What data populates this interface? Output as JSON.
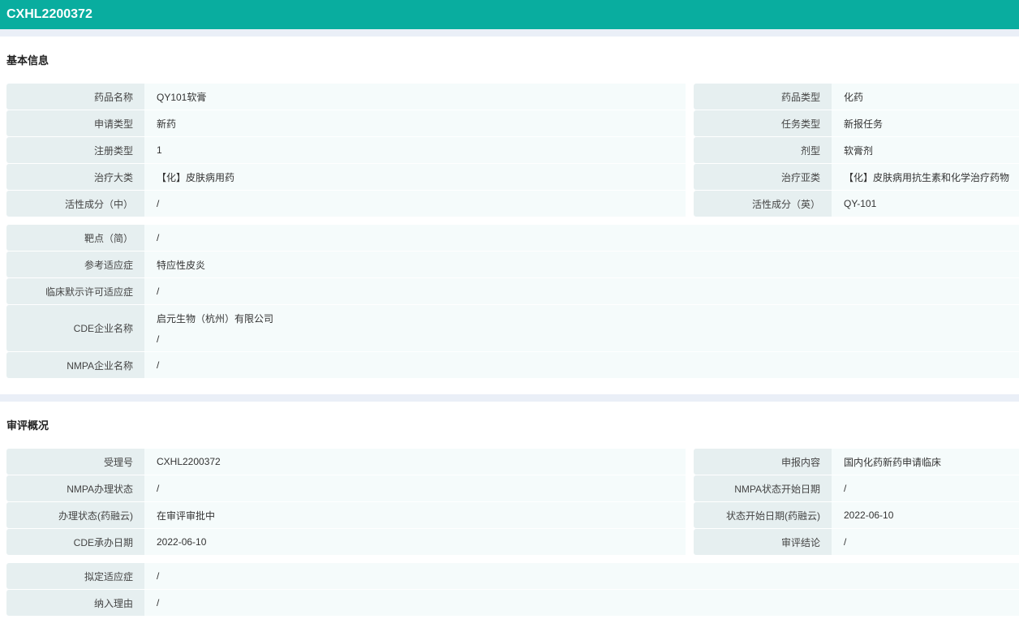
{
  "header": {
    "title": "CXHL2200372"
  },
  "basic": {
    "title": "基本信息",
    "left": [
      {
        "label": "药品名称",
        "value": "QY101软膏"
      },
      {
        "label": "申请类型",
        "value": "新药"
      },
      {
        "label": "注册类型",
        "value": "1"
      },
      {
        "label": "治疗大类",
        "value": "【化】皮肤病用药"
      },
      {
        "label": "活性成分（中）",
        "value": "/"
      }
    ],
    "right": [
      {
        "label": "药品类型",
        "value": "化药"
      },
      {
        "label": "任务类型",
        "value": "新报任务"
      },
      {
        "label": "剂型",
        "value": "软膏剂"
      },
      {
        "label": "治疗亚类",
        "value": "【化】皮肤病用抗生素和化学治疗药物"
      },
      {
        "label": "活性成分（英）",
        "value": "QY-101"
      }
    ],
    "full": [
      {
        "label": "靶点（简）",
        "value": "/"
      },
      {
        "label": "参考适应症",
        "value": "特应性皮炎"
      },
      {
        "label": "临床默示许可适应症",
        "value": "/"
      },
      {
        "label": "CDE企业名称",
        "values": [
          "启元生物（杭州）有限公司",
          "/"
        ]
      },
      {
        "label": "NMPA企业名称",
        "value": "/"
      }
    ]
  },
  "review": {
    "title": "审评概况",
    "left": [
      {
        "label": "受理号",
        "value": "CXHL2200372"
      },
      {
        "label": "NMPA办理状态",
        "value": "/"
      },
      {
        "label": "办理状态(药融云)",
        "value": "在审评审批中"
      },
      {
        "label": "CDE承办日期",
        "value": "2022-06-10"
      }
    ],
    "right": [
      {
        "label": "申报内容",
        "value": "国内化药新药申请临床"
      },
      {
        "label": "NMPA状态开始日期",
        "value": "/"
      },
      {
        "label": "状态开始日期(药融云)",
        "value": "2022-06-10"
      },
      {
        "label": "审评结论",
        "value": "/"
      }
    ],
    "full": [
      {
        "label": "拟定适应症",
        "value": "/"
      },
      {
        "label": "纳入理由",
        "value": "/"
      }
    ]
  }
}
